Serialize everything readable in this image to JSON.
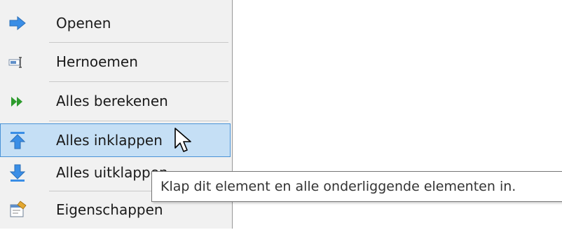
{
  "menu": {
    "items": [
      {
        "label": "Openen",
        "icon": "arrow-right-icon"
      },
      {
        "label": "Hernoemen",
        "icon": "rename-icon"
      },
      {
        "label": "Alles berekenen",
        "icon": "fast-forward-icon"
      },
      {
        "label": "Alles inklappen",
        "icon": "collapse-all-icon",
        "highlighted": true
      },
      {
        "label": "Alles uitklappen",
        "icon": "expand-all-icon"
      },
      {
        "label": "Eigenschappen",
        "icon": "properties-icon"
      }
    ]
  },
  "tooltip": {
    "text": "Klap dit element en alle onderliggende elementen in."
  },
  "colors": {
    "menu_background": "#f1f1f1",
    "highlight_background": "#c5dff5",
    "highlight_border": "#4a93d6",
    "icon_blue": "#3a8ee6",
    "icon_green": "#2e9b2e"
  }
}
